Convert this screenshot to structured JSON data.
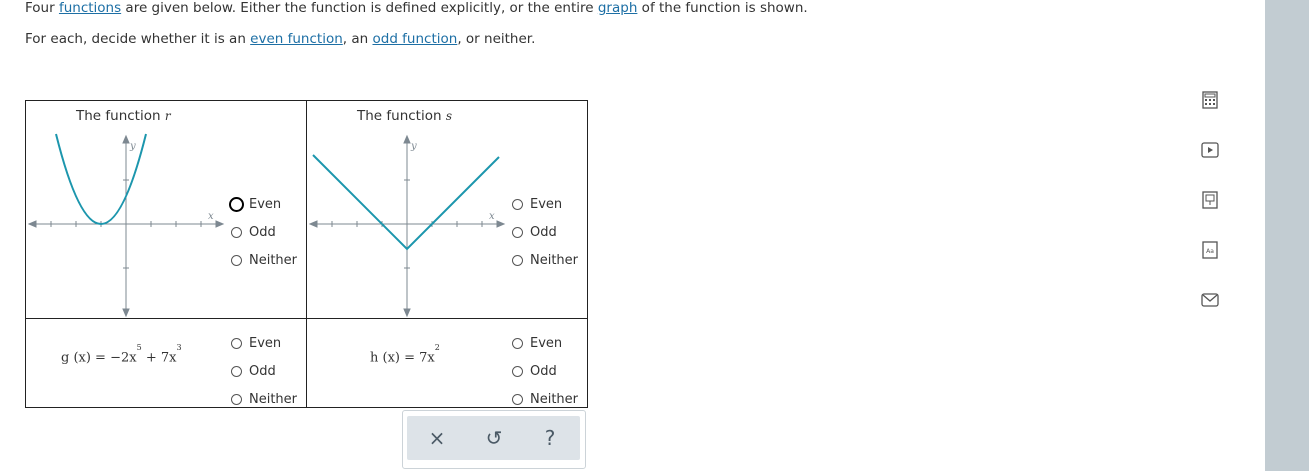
{
  "intro": {
    "line1": {
      "p1": "Four ",
      "link_functions": "functions",
      "p2": " are given below. Either the function is defined explicitly, or the entire ",
      "link_graph": "graph",
      "p3": " of the function is shown."
    },
    "line2": {
      "p1": "For each, decide whether it is an ",
      "link_even": "even function",
      "p2": ", an ",
      "link_odd": "odd function",
      "p3": ", or neither."
    }
  },
  "cells": {
    "r": {
      "prefix": "The function ",
      "var": "r"
    },
    "s": {
      "prefix": "The function ",
      "var": "s"
    },
    "g": {
      "lhs": "g (x) = −2x",
      "e1": "5",
      "mid": " + 7x",
      "e2": "3"
    },
    "h": {
      "lhs": "h (x) = 7x",
      "e1": "2"
    }
  },
  "axis": {
    "x": "x",
    "y": "y"
  },
  "options": {
    "even": "Even",
    "odd": "Odd",
    "neither": "Neither"
  },
  "toolbar": {
    "close": "×",
    "undo": "↺",
    "help": "?"
  },
  "colors": {
    "curve": "#1c96ad",
    "link": "#1d6fa5"
  },
  "icons": [
    "calculator-icon",
    "play-video-icon",
    "ebook-icon",
    "glossary-icon",
    "mail-icon"
  ]
}
